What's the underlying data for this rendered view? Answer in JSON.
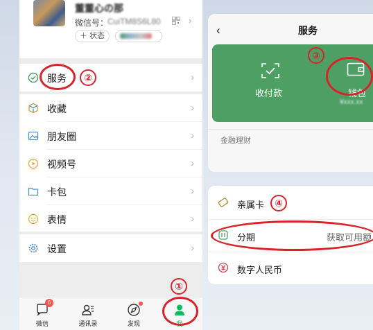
{
  "profile": {
    "nickname": "董董心の那",
    "wxid_label": "微信号：",
    "wxid_value": "CuiTM8S6L80",
    "status_label": "＋ 状态"
  },
  "menu": {
    "services": "服务",
    "favorites": "收藏",
    "moments": "朋友圈",
    "channels": "视频号",
    "cards": "卡包",
    "stickers": "表情",
    "settings": "设置"
  },
  "tabbar": {
    "chats": "微信",
    "contacts": "通讯录",
    "discover": "发现",
    "me": "我",
    "chats_badge": "6"
  },
  "services_page": {
    "title": "服务",
    "pay_label": "收付款",
    "wallet_label": "钱包",
    "wallet_sub": "¥xxx.xx",
    "finance_label": "金融理财",
    "family_card": "亲属卡",
    "installment": "分期",
    "installment_hint": "获取可用额",
    "digital_rmb": "数字人民币"
  },
  "annotations": [
    "①",
    "②",
    "③",
    "④"
  ],
  "colors": {
    "accent_green": "#4e9f63",
    "annotation_red": "#d8232a",
    "wechat_green": "#07c160"
  }
}
